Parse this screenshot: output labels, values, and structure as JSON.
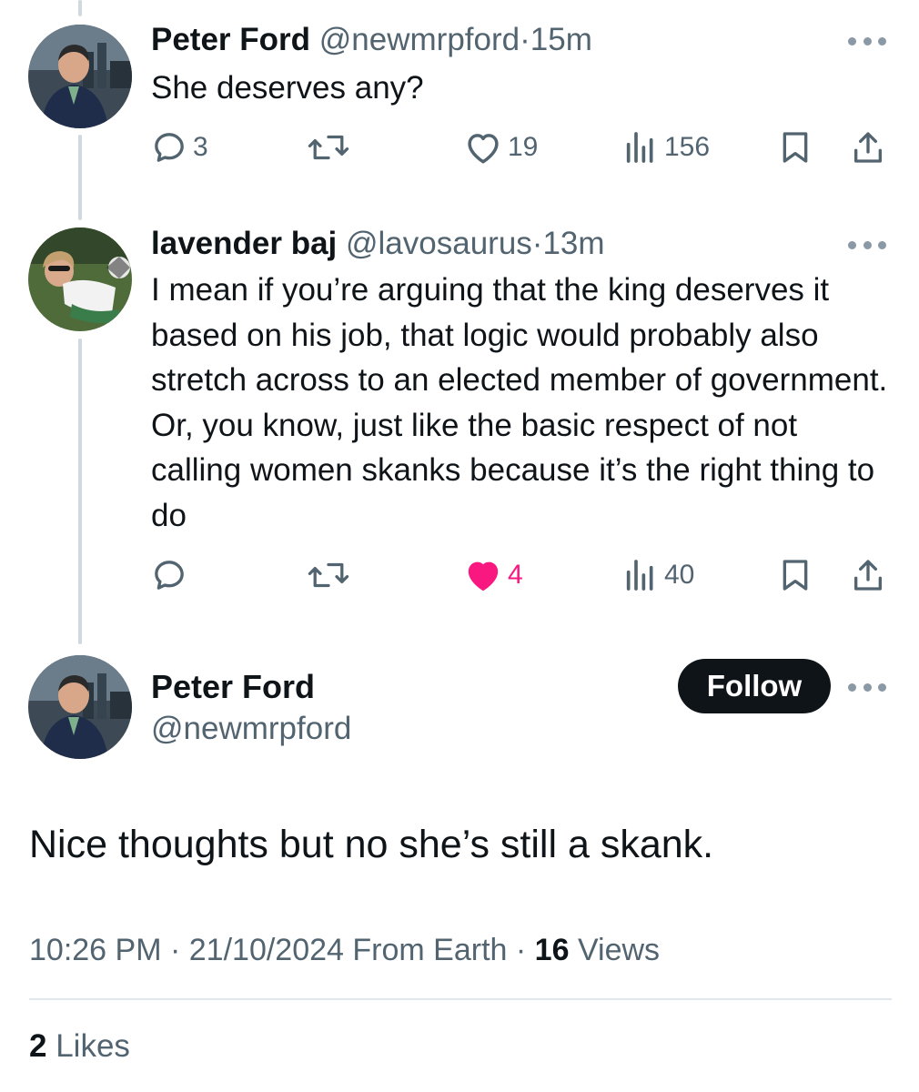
{
  "thread": [
    {
      "name": "Peter Ford",
      "handle": "@newmrpford",
      "time": "15m",
      "text": "She deserves any?",
      "replies": "3",
      "retweets": "",
      "likes": "19",
      "views": "156",
      "liked": false
    },
    {
      "name": "lavender baj",
      "handle": "@lavosaurus",
      "time": "13m",
      "text": "I mean if you’re arguing that the king deserves it based on his job, that logic would probably also stretch across to an elected member of government. Or, you know, just like the basic respect of not calling women skanks because it’s the right thing to do",
      "replies": "",
      "retweets": "",
      "likes": "4",
      "views": "40",
      "liked": true
    }
  ],
  "focused": {
    "name": "Peter Ford",
    "handle": "@newmrpford",
    "follow_label": "Follow",
    "text": "Nice thoughts but no she’s still a skank.",
    "time": "10:26 PM",
    "date": "21/10/2024",
    "source": "From Earth",
    "views_count": "16",
    "views_label": "Views",
    "likes_count": "2",
    "likes_label": "Likes"
  },
  "separator": "·",
  "colors": {
    "text_primary": "#0f1419",
    "text_secondary": "#536471",
    "like_pink": "#f91880",
    "thread_line": "#cfd9de"
  },
  "icons": {
    "reply": "reply-icon",
    "retweet": "retweet-icon",
    "like": "heart-icon",
    "views": "views-icon",
    "bookmark": "bookmark-icon",
    "share": "share-icon",
    "more": "more-icon"
  }
}
